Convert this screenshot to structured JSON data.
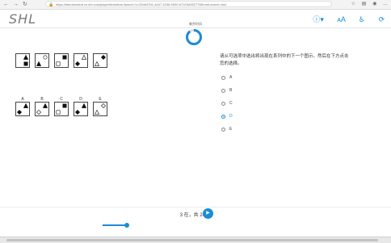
{
  "browser": {
    "url": "https://talentcentral.cn.shl.com/player/testdriver/launch?c=29dd4781-4d47-4038-9090-87103d35277f&fromLaunch=true",
    "lock_icon": "lock-icon"
  },
  "header": {
    "logo": "SHL",
    "icons": [
      "help-icon",
      "text-size-icon",
      "accessibility-icon",
      "exit-icon"
    ]
  },
  "progress": {
    "label": "剩余时间",
    "fraction": 0.9,
    "accent": "#1a8cd8",
    "value_text": ""
  },
  "question": {
    "text": "请从可选项中选出将出现在系列中的下一个图示。然后在下方点击您的选择。"
  },
  "sequence_tiles": [
    {
      "shapes": [
        {
          "kind": "triangle",
          "fill": "filled",
          "pos": "tr"
        },
        {
          "kind": "square",
          "fill": "filled",
          "pos": "br"
        }
      ]
    },
    {
      "shapes": [
        {
          "kind": "circle",
          "fill": "hollow",
          "pos": "tr"
        },
        {
          "kind": "triangle",
          "fill": "filled",
          "pos": "bl"
        }
      ]
    },
    {
      "shapes": [
        {
          "kind": "square",
          "fill": "filled",
          "pos": "tr"
        },
        {
          "kind": "square",
          "fill": "hollow",
          "pos": "bl"
        }
      ]
    },
    {
      "shapes": [
        {
          "kind": "triangle",
          "fill": "hollow",
          "pos": "tr"
        },
        {
          "kind": "diamond",
          "fill": "filled",
          "pos": "bl"
        }
      ]
    },
    {
      "shapes": [
        {
          "kind": "diamond",
          "fill": "filled",
          "pos": "tr"
        },
        {
          "kind": "triangle",
          "fill": "hollow",
          "pos": "bl"
        }
      ]
    }
  ],
  "options": [
    {
      "letter": "A",
      "shapes": [
        {
          "kind": "triangle",
          "fill": "filled",
          "pos": "tr"
        },
        {
          "kind": "diamond",
          "fill": "filled",
          "pos": "bl"
        }
      ]
    },
    {
      "letter": "B",
      "shapes": [
        {
          "kind": "triangle",
          "fill": "filled",
          "pos": "tr"
        },
        {
          "kind": "diamond",
          "fill": "hollow",
          "pos": "bl"
        }
      ]
    },
    {
      "letter": "C",
      "shapes": [
        {
          "kind": "square",
          "fill": "filled",
          "pos": "tr"
        },
        {
          "kind": "square",
          "fill": "hollow",
          "pos": "bl"
        }
      ]
    },
    {
      "letter": "D",
      "shapes": [
        {
          "kind": "triangle",
          "fill": "filled",
          "pos": "tr"
        },
        {
          "kind": "diamond",
          "fill": "filled",
          "pos": "bl"
        }
      ]
    },
    {
      "letter": "E",
      "shapes": [
        {
          "kind": "diamond",
          "fill": "hollow",
          "pos": "tr"
        },
        {
          "kind": "triangle",
          "fill": "hollow",
          "pos": "bl"
        }
      ]
    }
  ],
  "answers": [
    {
      "label": "A",
      "selected": false
    },
    {
      "label": "B",
      "selected": false
    },
    {
      "label": "C",
      "selected": false
    },
    {
      "label": "D",
      "selected": true
    },
    {
      "label": "E",
      "selected": false
    }
  ],
  "footer": {
    "page_text": "3 在，共 24",
    "next_icon": "arrow-right-icon",
    "slider_fraction": 0.15
  }
}
